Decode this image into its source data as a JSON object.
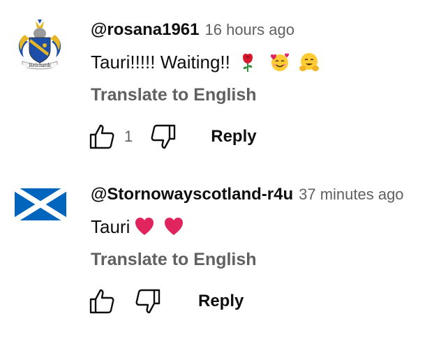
{
  "comments": [
    {
      "author": "@rosana1961",
      "time": "16 hours ago",
      "text": "Tauri!!!!! Waiting!!",
      "emojis": [
        "rose",
        "smiling-face-with-hearts",
        "hugging-face"
      ],
      "translate_label": "Translate to English",
      "like_count": "1",
      "reply_label": "Reply",
      "avatar": "coat-of-arms",
      "avatar_text": "Reichardt"
    },
    {
      "author": "@Stornowayscotland-r4u",
      "time": "37 minutes ago",
      "text": "Tauri",
      "emojis": [
        "red-heart",
        "red-heart"
      ],
      "translate_label": "Translate to English",
      "like_count": "",
      "reply_label": "Reply",
      "avatar": "scotland-flag"
    }
  ],
  "colors": {
    "text_primary": "#0f0f0f",
    "text_secondary": "#606060",
    "saltire_blue": "#0065bd",
    "heart_red": "#e0245e"
  }
}
